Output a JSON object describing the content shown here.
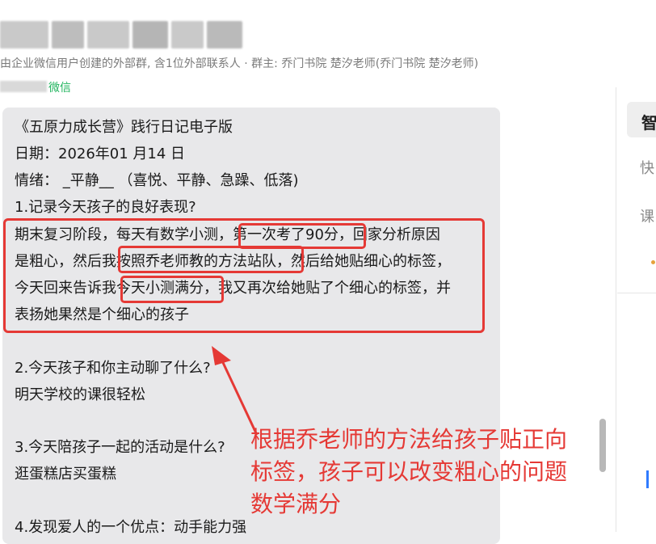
{
  "header": {
    "subtitle": "由企业微信用户创建的外部群, 含1位外部联系人 · 群主: 乔门书院 楚汐老师(乔门书院 楚汐老师)",
    "sender_tag": "微信"
  },
  "message": {
    "lines": [
      "《五原力成长营》践行日记电子版",
      "日期：2026年01 月14 日",
      "情绪：  _平静__   （喜悦、平静、急躁、低落)",
      "1.记录今天孩子的良好表现?",
      "期末复习阶段，每天有数学小测，第一次考了90分，回家分析原因",
      "是粗心，然后我按照乔老师教的方法站队，然后给她贴细心的标签，",
      "今天回来告诉我今天小测满分，我又再次给她贴了个细心的标签，并",
      "表扬她果然是个细心的孩子",
      "2.今天孩子和你主动聊了什么?",
      "明天学校的课很轻松",
      "3.今天陪孩子一起的活动是什么?",
      "逛蛋糕店买蛋糕",
      "4.发现爱人的一个优点：动手能力强"
    ]
  },
  "annotation": {
    "lines": [
      "根据乔老师的方法给孩子贴正向",
      "标签，孩子可以改变粗心的问题",
      "数学满分"
    ],
    "color": "#e53935"
  },
  "right_panel": {
    "active_label": "智",
    "items": [
      "快",
      "课"
    ]
  }
}
